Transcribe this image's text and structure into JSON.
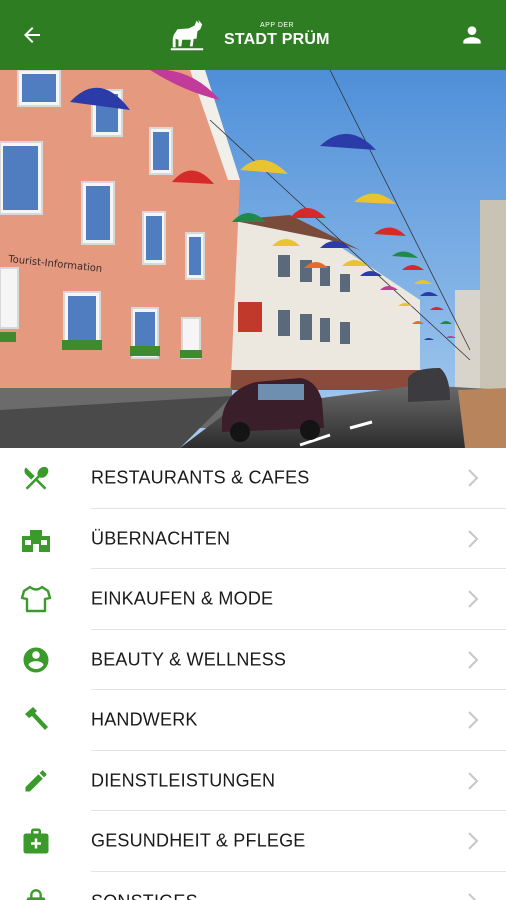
{
  "header": {
    "back_icon": "arrow-left-icon",
    "logo_small": "APP DER",
    "logo_big": "STADT PRÜM",
    "user_icon": "person-icon",
    "brand_color": "#2f7d22"
  },
  "hero": {
    "sign_text": "Tourist-Information"
  },
  "menu": {
    "accent_color": "#3a9a2a",
    "items": [
      {
        "label": "RESTAURANTS & CAFES",
        "icon": "fork-knife-icon"
      },
      {
        "label": "ÜBERNACHTEN",
        "icon": "hotel-icon"
      },
      {
        "label": "EINKAUFEN & MODE",
        "icon": "shirt-icon"
      },
      {
        "label": "BEAUTY & WELLNESS",
        "icon": "account-circle-icon"
      },
      {
        "label": "HANDWERK",
        "icon": "hammer-icon"
      },
      {
        "label": "DIENSTLEISTUNGEN",
        "icon": "pencil-icon"
      },
      {
        "label": "GESUNDHEIT & PFLEGE",
        "icon": "medical-bag-icon"
      },
      {
        "label": "SONSTIGES",
        "icon": "lock-icon"
      }
    ]
  }
}
